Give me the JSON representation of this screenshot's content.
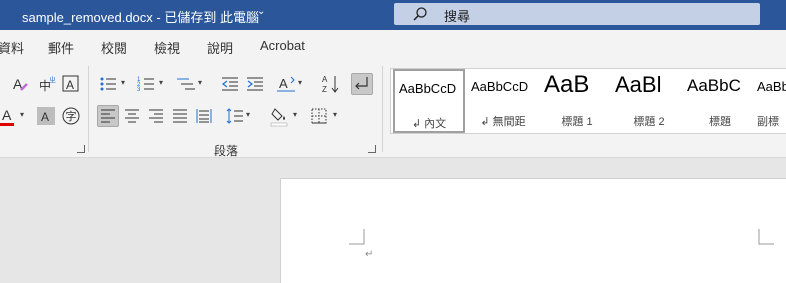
{
  "window": {
    "title": "sample_removed.docx - 已儲存到 此電腦",
    "title_caret": "⌄",
    "search_placeholder": "搜尋"
  },
  "tabs": [
    "資料",
    "郵件",
    "校閱",
    "檢視",
    "說明",
    "Acrobat"
  ],
  "ribbon": {
    "font_group": {
      "clear_format_icon": "A",
      "phonetic_icon": "中",
      "char_border_icon": "A",
      "font_color_icon": "A",
      "font_color": "#e00000",
      "char_shading_icon": "A",
      "enclose_char_icon": "字"
    },
    "paragraph_group": {
      "label": "段落"
    },
    "styles": [
      {
        "sample": "AaBbCcD",
        "name": "↲ 內文"
      },
      {
        "sample": "AaBbCcD",
        "name": "↲ 無間距"
      },
      {
        "sample": "AaB",
        "name": "標題 1"
      },
      {
        "sample": "AaBl",
        "name": "標題 2"
      },
      {
        "sample": "AaBbC",
        "name": "標題"
      },
      {
        "sample": "AaBbC",
        "name": "副標"
      }
    ]
  },
  "document": {
    "paragraph_mark": "↵"
  },
  "colors": {
    "titlebar": "#2b579a",
    "search_box": "#c3d0e6",
    "ribbon": "#f3f3f3"
  }
}
